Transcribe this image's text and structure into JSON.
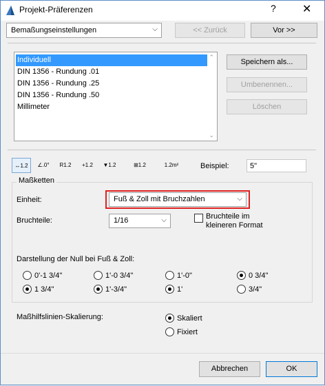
{
  "window": {
    "title": "Projekt-Präferenzen",
    "help_label": "?",
    "close_label": "✕"
  },
  "nav": {
    "page_select": "Bemaßungseinstellungen",
    "back_label": "<< Zurück",
    "next_label": "Vor >>"
  },
  "presets": {
    "items": [
      {
        "label": "Individuell",
        "selected": true
      },
      {
        "label": "DIN 1356 - Rundung .01"
      },
      {
        "label": "DIN 1356 - Rundung .25"
      },
      {
        "label": "DIN 1356 - Rundung .50"
      },
      {
        "label": "Millimeter"
      }
    ],
    "save_as_label": "Speichern als...",
    "rename_label": "Umbenennen...",
    "delete_label": "Löschen"
  },
  "toolbar": {
    "tools": [
      {
        "name": "linear-dimension-tool",
        "glyph": "↔1.2",
        "active": true
      },
      {
        "name": "angle-dimension-tool",
        "glyph": "∠.0°"
      },
      {
        "name": "radial-dimension-tool",
        "glyph": "R1.2"
      },
      {
        "name": "level-dimension-tool",
        "glyph": "+1.2"
      },
      {
        "name": "elevation-dimension-tool",
        "glyph": "▼1.2"
      },
      {
        "name": "door-window-dimension-tool",
        "glyph": "⊞1.2"
      },
      {
        "name": "area-calculation-tool",
        "glyph": "1.2m²"
      }
    ],
    "example_label": "Beispiel:",
    "example_value": "5\""
  },
  "massketten": {
    "group_label": "Maßketten",
    "unit_label": "Einheit:",
    "unit_value": "Fuß & Zoll mit Bruchzahlen",
    "fraction_label": "Bruchteile:",
    "fraction_value": "1/16",
    "smaller_format_label_1": "Bruchteile im",
    "smaller_format_label_2": "kleineren Format",
    "smaller_format_checked": false,
    "zero_display_label": "Darstellung der Null bei Fuß & Zoll:",
    "zero_options_row1": [
      {
        "label": "0'-1 3/4\"",
        "checked": false
      },
      {
        "label": "1'-0 3/4\"",
        "checked": false
      },
      {
        "label": "1'-0\"",
        "checked": false
      },
      {
        "label": "0 3/4\"",
        "checked": true
      }
    ],
    "zero_options_row2": [
      {
        "label": "1 3/4\"",
        "checked": true
      },
      {
        "label": "1'-3/4\"",
        "checked": true
      },
      {
        "label": "1'",
        "checked": true
      },
      {
        "label": "3/4\"",
        "checked": false
      }
    ]
  },
  "scaling": {
    "label": "Maßhilfslinien-Skalierung:",
    "options": [
      {
        "label": "Skaliert",
        "checked": true
      },
      {
        "label": "Fixiert",
        "checked": false
      }
    ]
  },
  "footer": {
    "cancel_label": "Abbrechen",
    "ok_label": "OK"
  }
}
